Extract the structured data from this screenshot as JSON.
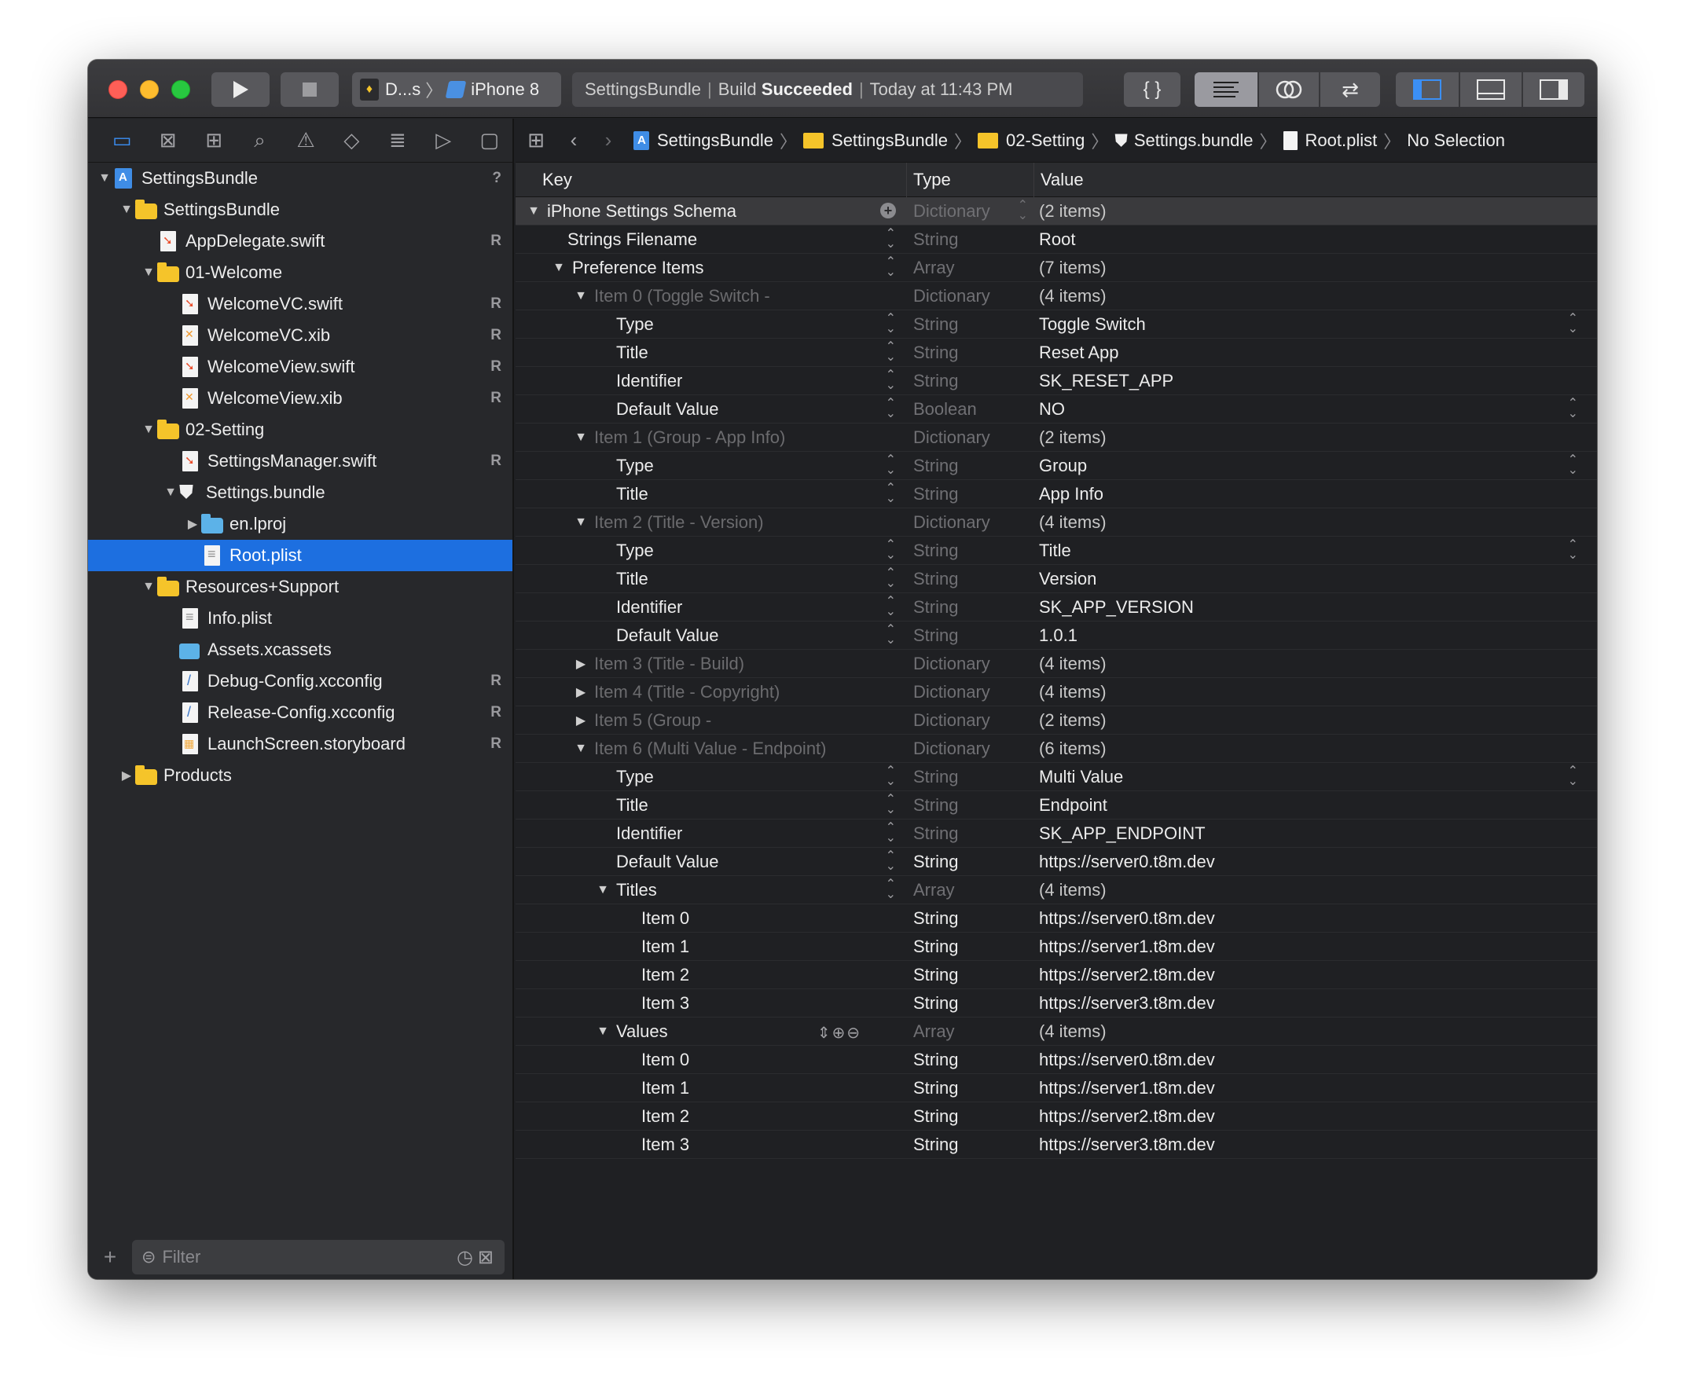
{
  "toolbar": {
    "scheme_name": "D...s",
    "device": "iPhone 8",
    "activity_project": "SettingsBundle",
    "activity_status_prefix": "Build",
    "activity_status": "Succeeded",
    "activity_time": "Today at 11:43 PM",
    "icons": [
      "run-icon",
      "stop-icon",
      "code-review-icon",
      "standard-editor-icon",
      "assistant-editor-icon",
      "version-editor-icon",
      "navigator-toggle-icon",
      "debug-area-toggle-icon",
      "inspector-toggle-icon"
    ]
  },
  "navigator": {
    "tab_icons": [
      "project-navigator-icon",
      "source-control-icon",
      "symbol-navigator-icon",
      "find-navigator-icon",
      "issue-navigator-icon",
      "test-navigator-icon",
      "debug-navigator-icon",
      "breakpoint-navigator-icon",
      "report-navigator-icon"
    ],
    "items": [
      {
        "label": "SettingsBundle",
        "badge": "?"
      },
      {
        "label": "SettingsBundle",
        "badge": ""
      },
      {
        "label": "AppDelegate.swift",
        "badge": "R"
      },
      {
        "label": "01-Welcome",
        "badge": ""
      },
      {
        "label": "WelcomeVC.swift",
        "badge": "R"
      },
      {
        "label": "WelcomeVC.xib",
        "badge": "R"
      },
      {
        "label": "WelcomeView.swift",
        "badge": "R"
      },
      {
        "label": "WelcomeView.xib",
        "badge": "R"
      },
      {
        "label": "02-Setting",
        "badge": ""
      },
      {
        "label": "SettingsManager.swift",
        "badge": "R"
      },
      {
        "label": "Settings.bundle",
        "badge": ""
      },
      {
        "label": "en.lproj",
        "badge": ""
      },
      {
        "label": "Root.plist",
        "badge": ""
      },
      {
        "label": "Resources+Support",
        "badge": ""
      },
      {
        "label": "Info.plist",
        "badge": ""
      },
      {
        "label": "Assets.xcassets",
        "badge": ""
      },
      {
        "label": "Debug-Config.xcconfig",
        "badge": "R"
      },
      {
        "label": "Release-Config.xcconfig",
        "badge": "R"
      },
      {
        "label": "LaunchScreen.storyboard",
        "badge": "R"
      },
      {
        "label": "Products",
        "badge": ""
      }
    ],
    "filter_placeholder": "Filter"
  },
  "jumpbar": {
    "crumbs": [
      "SettingsBundle",
      "SettingsBundle",
      "02-Setting",
      "Settings.bundle",
      "Root.plist",
      "No Selection"
    ]
  },
  "plist": {
    "headers": {
      "key": "Key",
      "type": "Type",
      "value": "Value"
    },
    "rows": [
      {
        "key": "iPhone Settings Schema",
        "type": "Dictionary",
        "value": "(2 items)"
      },
      {
        "key": "Strings Filename",
        "type": "String",
        "value": "Root"
      },
      {
        "key": "Preference Items",
        "type": "Array",
        "value": "(7 items)"
      },
      {
        "key": "Item 0 (Toggle Switch -",
        "type": "Dictionary",
        "value": "(4 items)"
      },
      {
        "key": "Type",
        "type": "String",
        "value": "Toggle Switch"
      },
      {
        "key": "Title",
        "type": "String",
        "value": "Reset App"
      },
      {
        "key": "Identifier",
        "type": "String",
        "value": "SK_RESET_APP"
      },
      {
        "key": "Default Value",
        "type": "Boolean",
        "value": "NO"
      },
      {
        "key": "Item 1 (Group - App Info)",
        "type": "Dictionary",
        "value": "(2 items)"
      },
      {
        "key": "Type",
        "type": "String",
        "value": "Group"
      },
      {
        "key": "Title",
        "type": "String",
        "value": "App Info"
      },
      {
        "key": "Item 2 (Title - Version)",
        "type": "Dictionary",
        "value": "(4 items)"
      },
      {
        "key": "Type",
        "type": "String",
        "value": "Title"
      },
      {
        "key": "Title",
        "type": "String",
        "value": "Version"
      },
      {
        "key": "Identifier",
        "type": "String",
        "value": "SK_APP_VERSION"
      },
      {
        "key": "Default Value",
        "type": "String",
        "value": "1.0.1"
      },
      {
        "key": "Item 3 (Title - Build)",
        "type": "Dictionary",
        "value": "(4 items)"
      },
      {
        "key": "Item 4 (Title - Copyright)",
        "type": "Dictionary",
        "value": "(4 items)"
      },
      {
        "key": "Item 5 (Group -",
        "type": "Dictionary",
        "value": "(2 items)"
      },
      {
        "key": "Item 6 (Multi Value - Endpoint)",
        "type": "Dictionary",
        "value": "(6 items)"
      },
      {
        "key": "Type",
        "type": "String",
        "value": "Multi Value"
      },
      {
        "key": "Title",
        "type": "String",
        "value": "Endpoint"
      },
      {
        "key": "Identifier",
        "type": "String",
        "value": "SK_APP_ENDPOINT"
      },
      {
        "key": "Default Value",
        "type": "String",
        "value": "https://server0.t8m.dev"
      },
      {
        "key": "Titles",
        "type": "Array",
        "value": "(4 items)"
      },
      {
        "key": "Item 0",
        "type": "String",
        "value": "https://server0.t8m.dev"
      },
      {
        "key": "Item 1",
        "type": "String",
        "value": "https://server1.t8m.dev"
      },
      {
        "key": "Item 2",
        "type": "String",
        "value": "https://server2.t8m.dev"
      },
      {
        "key": "Item 3",
        "type": "String",
        "value": "https://server3.t8m.dev"
      },
      {
        "key": "Values",
        "type": "Array",
        "value": "(4 items)"
      },
      {
        "key": "Item 0",
        "type": "String",
        "value": "https://server0.t8m.dev"
      },
      {
        "key": "Item 1",
        "type": "String",
        "value": "https://server1.t8m.dev"
      },
      {
        "key": "Item 2",
        "type": "String",
        "value": "https://server2.t8m.dev"
      },
      {
        "key": "Item 3",
        "type": "String",
        "value": "https://server3.t8m.dev"
      }
    ]
  },
  "colors": {
    "selection": "#1d6fe0",
    "folder": "#f5c42a",
    "accent": "#3b8ff5"
  }
}
